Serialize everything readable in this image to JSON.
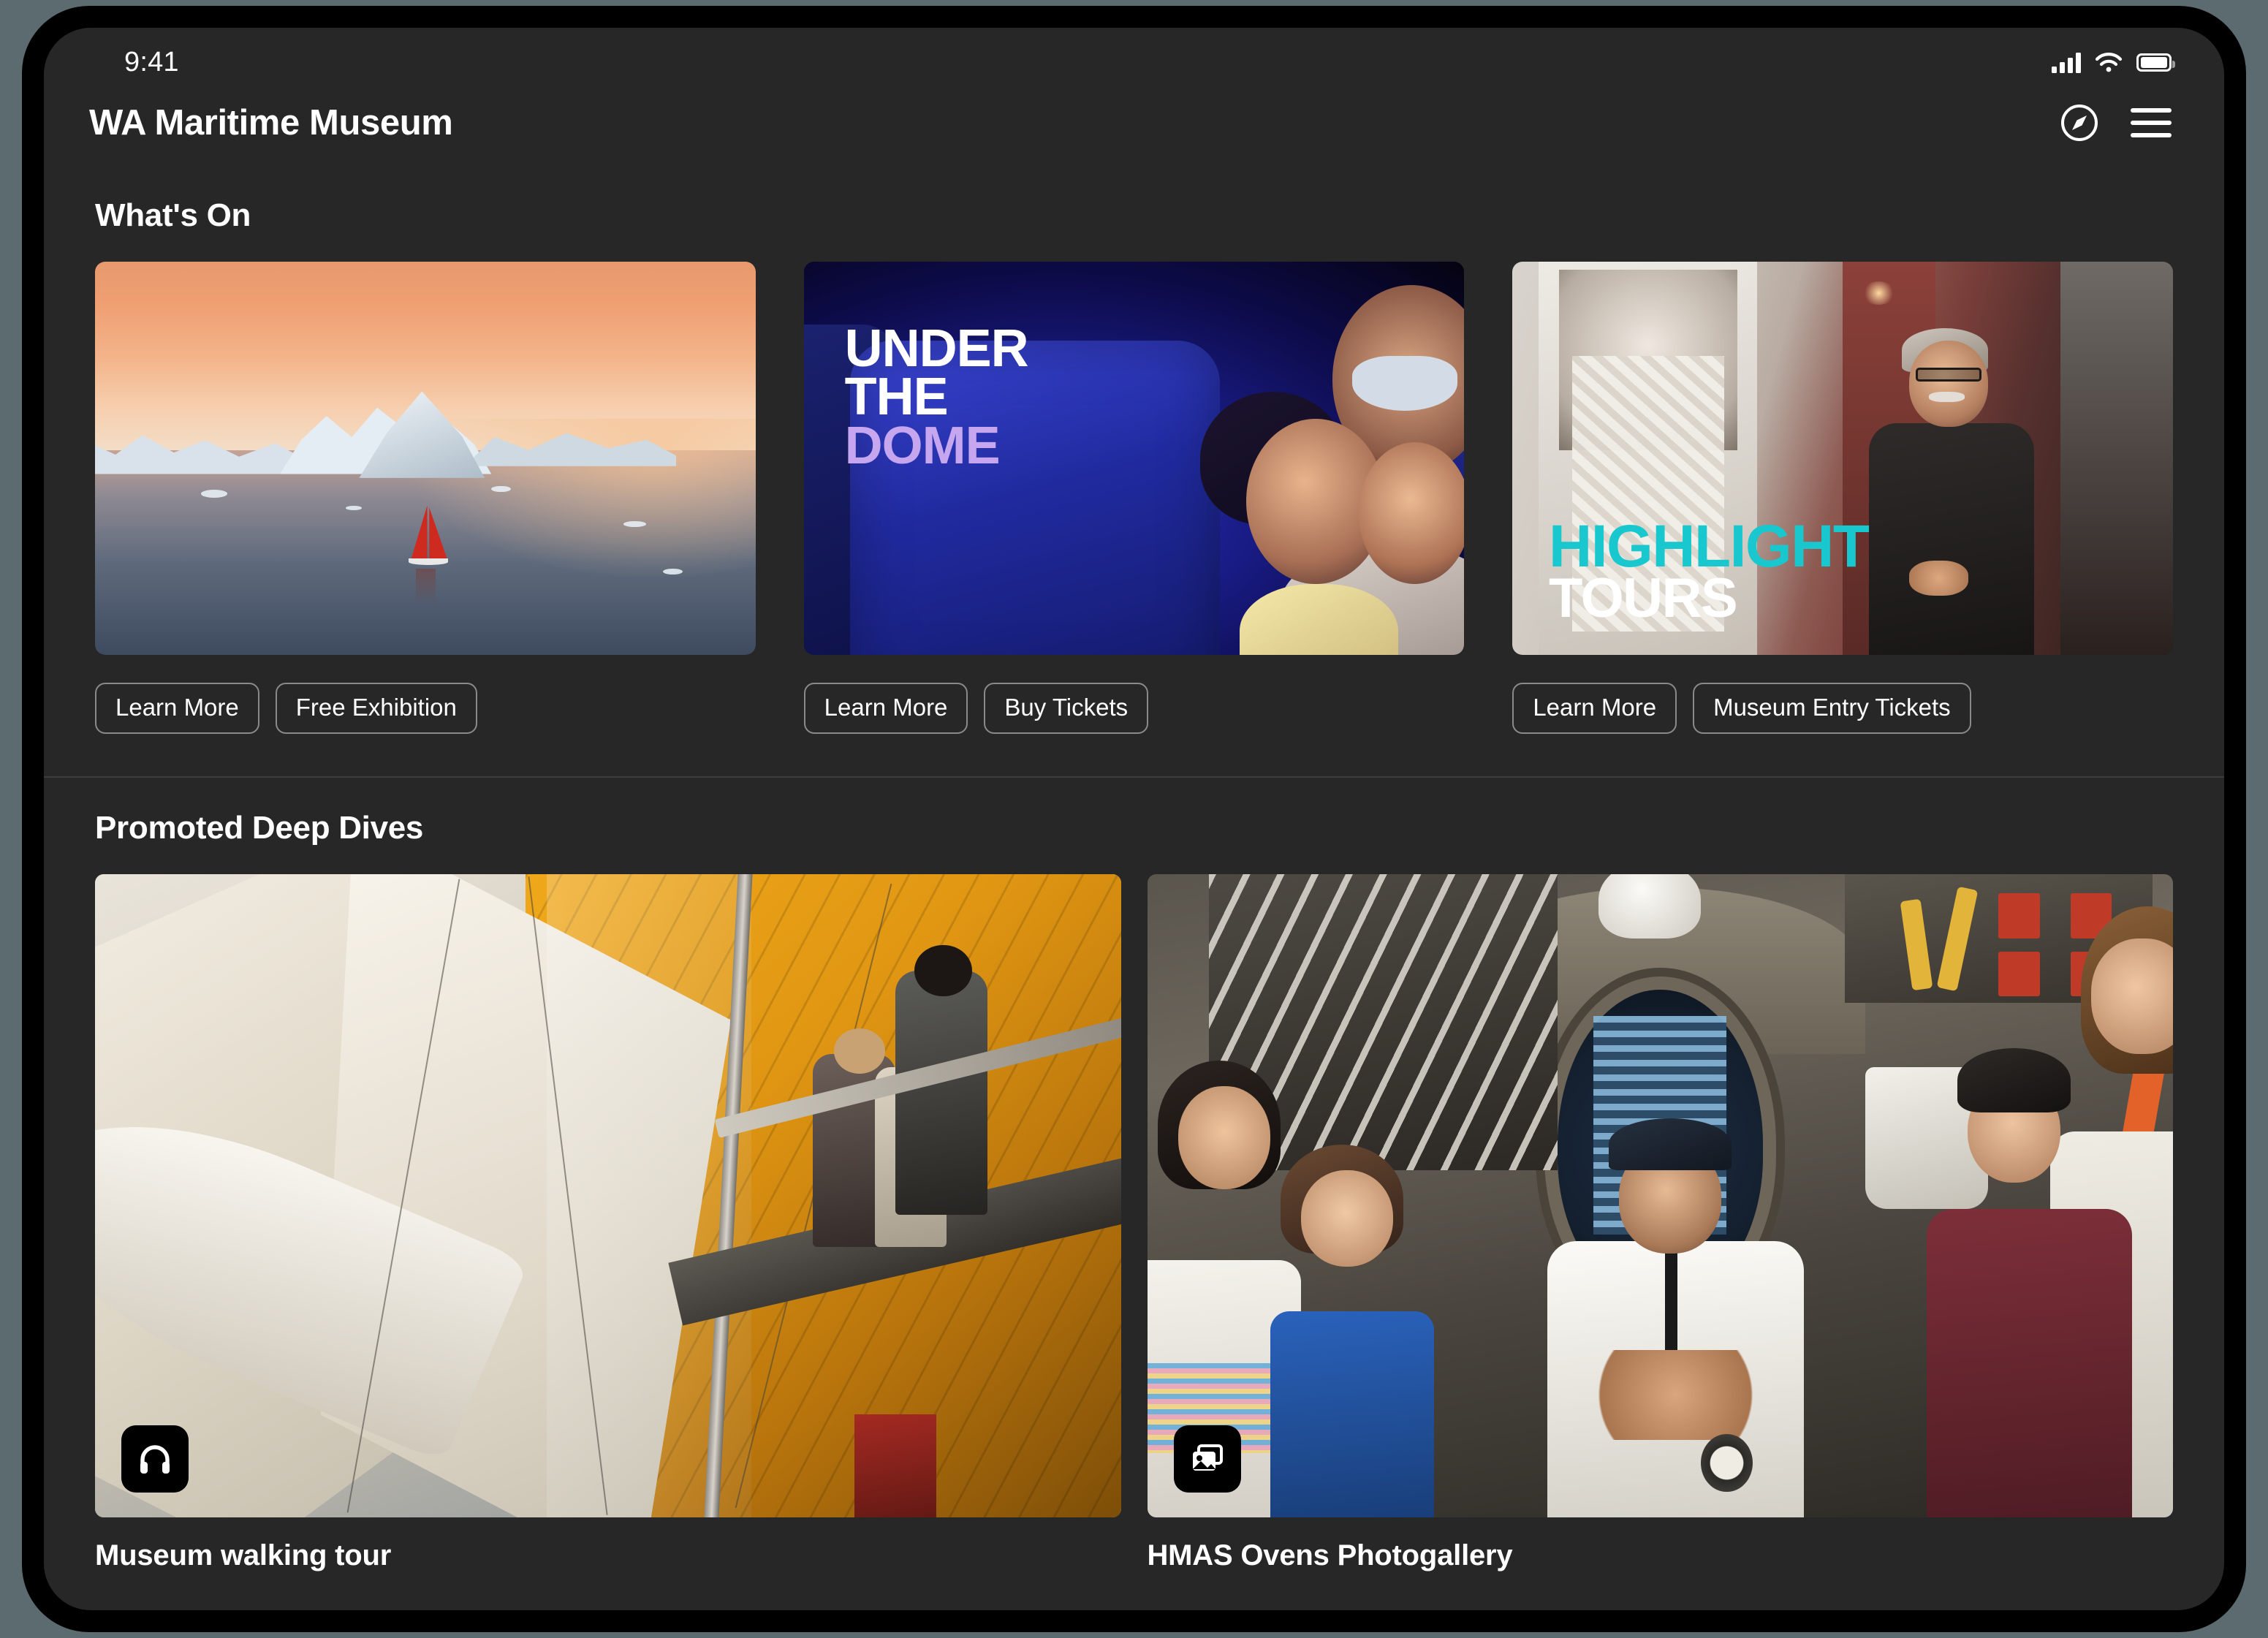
{
  "status_bar": {
    "time": "9:41",
    "signal_icon": "cellular-signal-icon",
    "wifi_icon": "wifi-icon",
    "battery_icon": "battery-icon"
  },
  "app_bar": {
    "title": "WA Maritime Museum",
    "explore_icon": "compass-icon",
    "menu_icon": "hamburger-menu-icon"
  },
  "sections": [
    {
      "id": "whats-on",
      "title": "What's On",
      "cards": [
        {
          "id": "polar-exhibition",
          "image_alt": "Red-sailed yacht among icebergs at sunset",
          "buttons": [
            "Learn More",
            "Free Exhibition"
          ]
        },
        {
          "id": "under-the-dome",
          "image_alt": "Family watching a planetarium dome show",
          "artwork_text": {
            "line1": "UNDER",
            "line2": "THE",
            "line3": "DOME"
          },
          "buttons": [
            "Learn More",
            "Buy Tickets"
          ]
        },
        {
          "id": "highlight-tours",
          "image_alt": "Museum guide speaking in front of an exhibit",
          "artwork_text": {
            "line1": "HIGHLIGHT",
            "line2": "TOURS"
          },
          "buttons": [
            "Learn More",
            "Museum Entry Tickets"
          ]
        }
      ]
    },
    {
      "id": "promoted-deep-dives",
      "title": "Promoted Deep Dives",
      "cards": [
        {
          "id": "museum-walking-tour",
          "caption": "Museum walking tour",
          "badge_icon": "headphones-icon",
          "image_alt": "Visitors on a walkway beside a large sailing yacht inside the museum"
        },
        {
          "id": "hmas-ovens-photogallery",
          "caption": "HMAS Ovens Photogallery",
          "badge_icon": "photo-gallery-icon",
          "image_alt": "Guide talking to visitors inside the HMAS Ovens submarine"
        }
      ]
    }
  ],
  "colors": {
    "screen_background": "#272727",
    "bezel": "#000000",
    "text_primary": "#ffffff",
    "pill_border": "#8a8a8a",
    "divider": "#3c3c3c",
    "dome_accent": "#c7a6f0",
    "tours_accent": "#18c8ce"
  }
}
